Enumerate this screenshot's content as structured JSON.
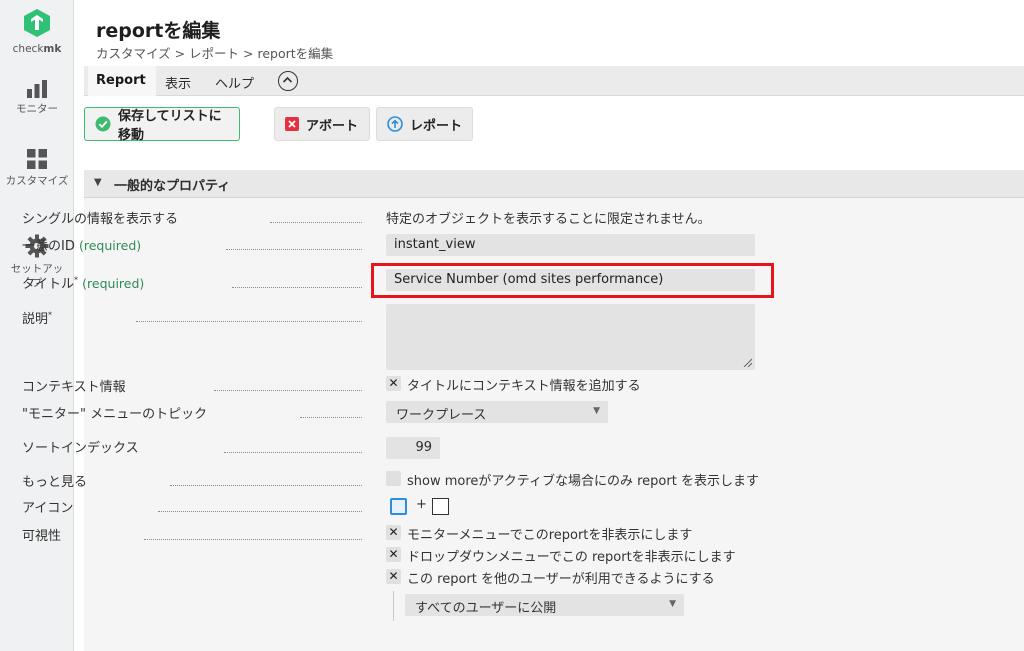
{
  "sidebar": {
    "logo_text_a": "check",
    "logo_text_b": "mk",
    "items": [
      {
        "label": "モニター",
        "icon": "monitor-icon"
      },
      {
        "label": "カスタマイズ",
        "icon": "customize-icon"
      },
      {
        "label": "セットアップ",
        "icon": "setup-gear-icon"
      }
    ]
  },
  "header": {
    "title": "reportを編集",
    "breadcrumb": "カスタマイズ > レポート > reportを編集"
  },
  "menu": {
    "items": [
      "Report",
      "表示",
      "ヘルプ"
    ]
  },
  "toolbar": {
    "save_label": "保存してリストに移動",
    "abort_label": "アボート",
    "report_label": "レポート"
  },
  "section": {
    "title": "一般的なプロパティ"
  },
  "form": {
    "single_info_label": "シングルの情報を表示する",
    "single_info_value": "特定のオブジェクトを表示することに限定されません。",
    "id_label": "一意のID",
    "id_required": "(required)",
    "id_value": "instant_view",
    "title_label": "タイトル",
    "title_star": "*",
    "title_required": "(required)",
    "title_value": "Service Number (omd sites performance)",
    "desc_label": "説明",
    "desc_star": "*",
    "context_label": "コンテキスト情報",
    "context_check": "タイトルにコンテキスト情報を追加する",
    "topic_label": "\"モニター\" メニューのトピック",
    "topic_value": "ワークプレース",
    "sort_label": "ソートインデックス",
    "sort_value": "99",
    "more_label": "もっと見る",
    "more_check": "show moreがアクティブな場合にのみ report を表示します",
    "icon_label": "アイコン",
    "icon_plus": "+",
    "visibility_label": "可視性",
    "vis_check_1": "モニターメニューでこのreportを非表示にします",
    "vis_check_2": "ドロップダウンメニューでこの reportを非表示にします",
    "vis_check_3": "この report を他のユーザーが利用できるようにする",
    "vis_select": "すべてのユーザーに公開",
    "check_mark": "✕"
  },
  "colors": {
    "accent_green": "#3dbc6f",
    "highlight_red": "#e8141b",
    "abort_red": "#e2323f",
    "report_blue": "#2d8fdc"
  }
}
